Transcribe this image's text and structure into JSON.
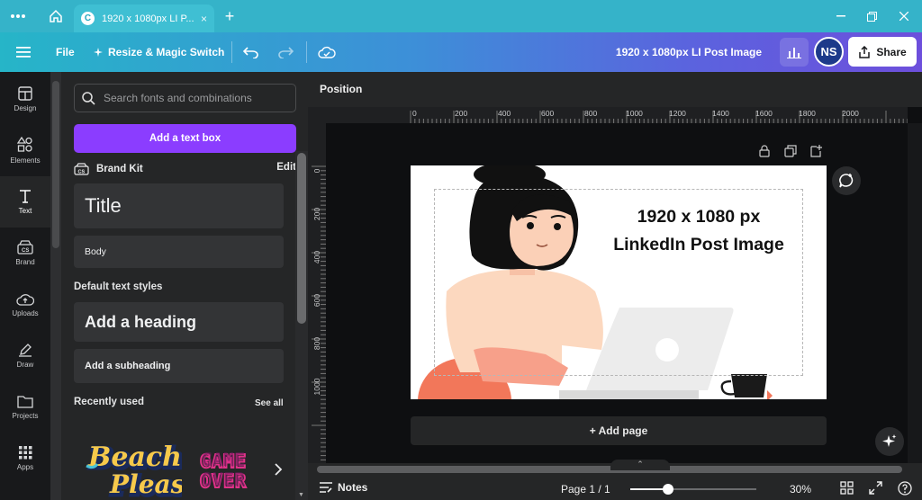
{
  "browser": {
    "tab_title": "1920 x 1080px LI P...",
    "tab_close": "×",
    "new_tab": "+",
    "favicon_letter": "C"
  },
  "header": {
    "file_label": "File",
    "resize_label": "Resize & Magic Switch",
    "doc_title": "1920 x 1080px LI Post Image",
    "avatar_initials": "NS",
    "share_label": "Share"
  },
  "rail": {
    "items": [
      {
        "label": "Design",
        "icon": "layout-icon"
      },
      {
        "label": "Elements",
        "icon": "shapes-icon"
      },
      {
        "label": "Text",
        "icon": "text-icon"
      },
      {
        "label": "Brand",
        "icon": "brand-icon"
      },
      {
        "label": "Uploads",
        "icon": "upload-icon"
      },
      {
        "label": "Draw",
        "icon": "pen-icon"
      },
      {
        "label": "Projects",
        "icon": "folder-icon"
      },
      {
        "label": "Apps",
        "icon": "grid-icon"
      }
    ],
    "active": "Text"
  },
  "panel": {
    "search_placeholder": "Search fonts and combinations",
    "add_textbox_label": "Add a text box",
    "brand_kit_label": "Brand Kit",
    "brand_kit_edit": "Edit",
    "title_sample": "Title",
    "body_sample": "Body",
    "default_styles_label": "Default text styles",
    "heading_label": "Add a heading",
    "subheading_label": "Add a subheading",
    "recently_used_label": "Recently used",
    "see_all_label": "See all",
    "recent_thumbs": [
      {
        "line1": "Beach",
        "line2": "Please"
      },
      {
        "line1": "GAME",
        "line2": "OVER"
      }
    ]
  },
  "toolbar": {
    "position_label": "Position"
  },
  "ruler": {
    "top_ticks": [
      "0",
      "200",
      "400",
      "600",
      "800",
      "1000",
      "1200",
      "1400",
      "1600",
      "1800",
      "2000"
    ],
    "left_ticks": [
      "0",
      "200",
      "400",
      "600",
      "800",
      "1000"
    ]
  },
  "canvas": {
    "line1": "1920 x 1080 px",
    "line2": "LinkedIn Post Image"
  },
  "workspace": {
    "add_page_label": "+ Add page"
  },
  "footer": {
    "notes_label": "Notes",
    "page_label": "Page 1 / 1",
    "zoom_value": 30,
    "zoom_label": "30%",
    "zoom_fraction": 0.3
  },
  "colors": {
    "accent_purple": "#8b3dff",
    "tab_bar": "#35b3c9",
    "avatar": "#1d3a8a"
  }
}
